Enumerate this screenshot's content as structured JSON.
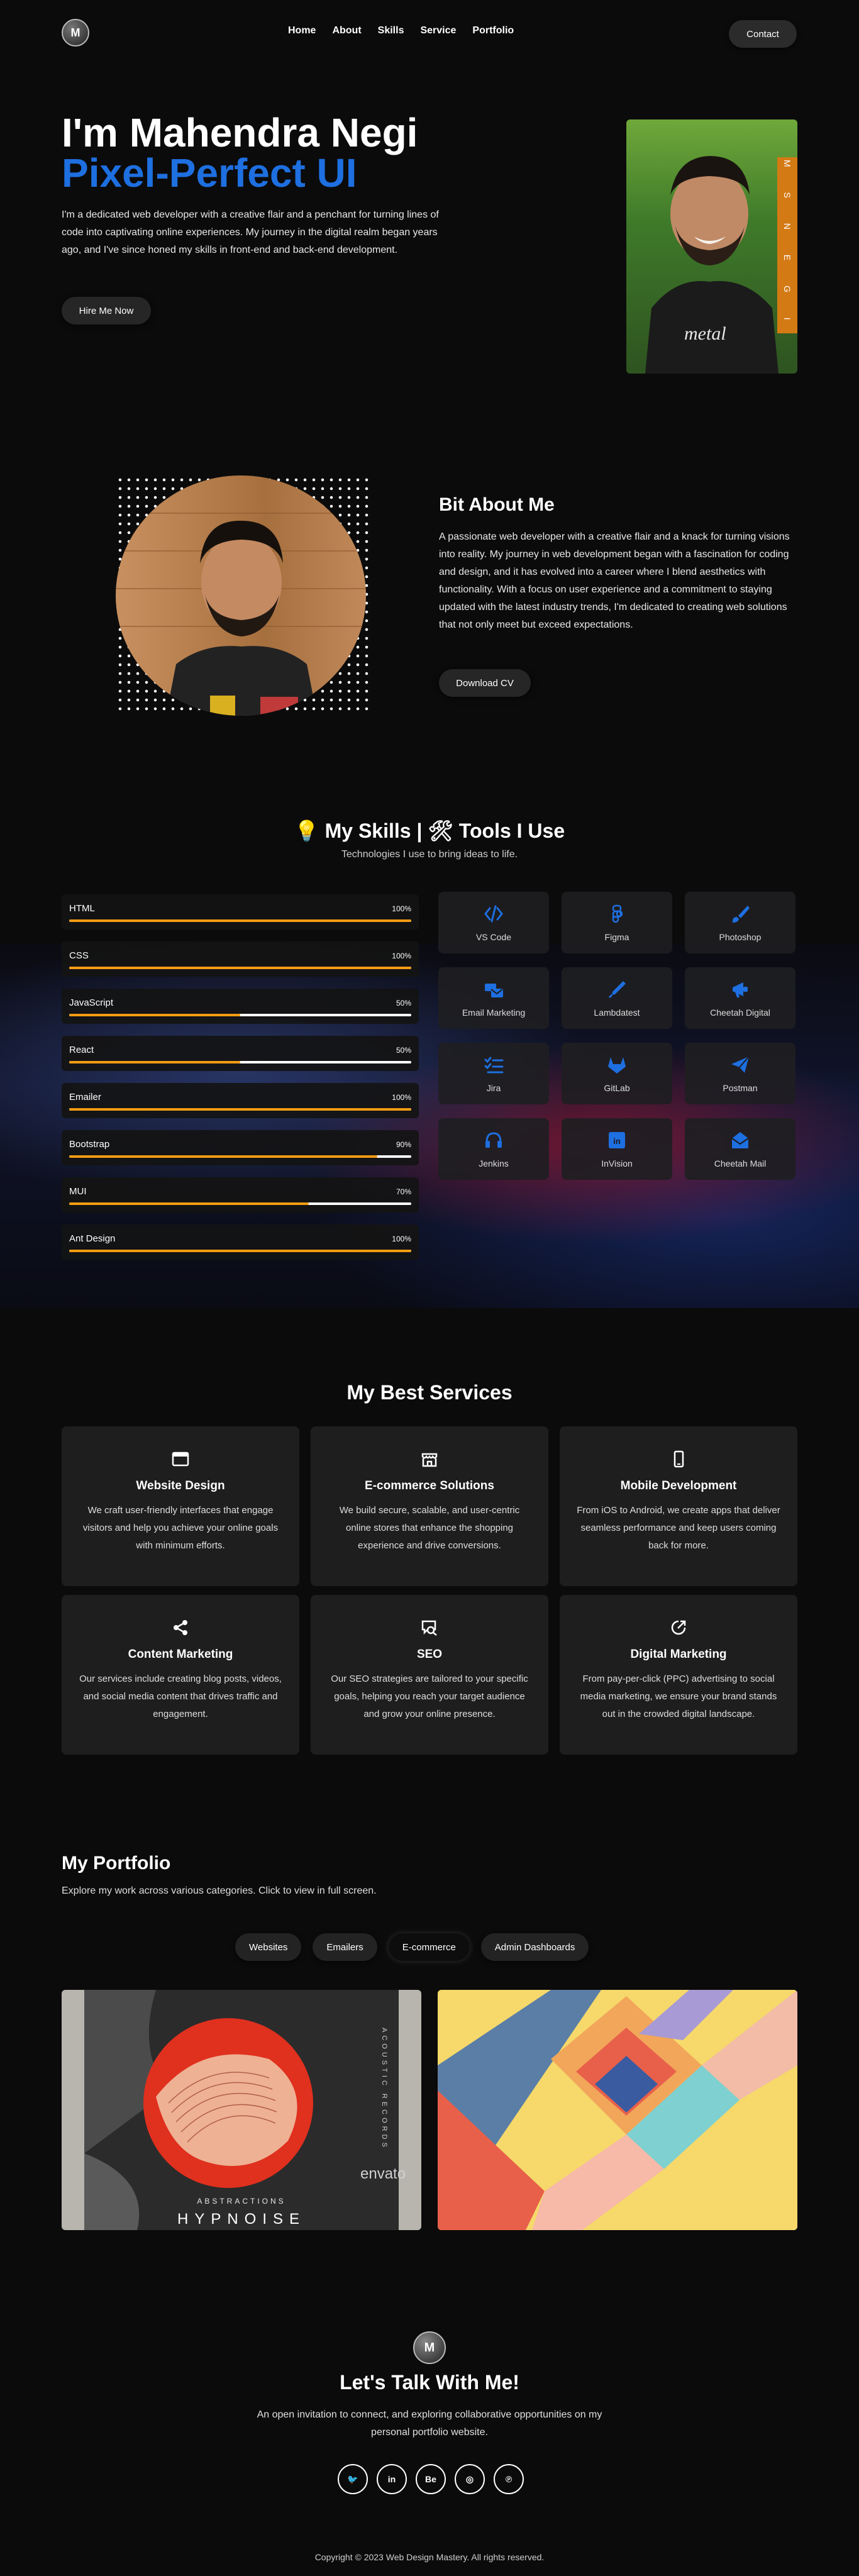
{
  "nav": {
    "logo": "M",
    "links": [
      "Home",
      "About",
      "Skills",
      "Service",
      "Portfolio"
    ],
    "contact": "Contact"
  },
  "hero": {
    "title": "I'm Mahendra Negi",
    "subtitle": "Pixel-Perfect UI",
    "description": "I'm a dedicated web developer with a creative flair and a penchant for turning lines of code into captivating online experiences. My journey in the digital realm began years ago, and I've since honed my skills in front-end and back-end development.",
    "button": "Hire Me Now",
    "photo_label": "M S N E G I",
    "shirt_text": "metal"
  },
  "about": {
    "title": "Bit About Me",
    "description": "A passionate web developer with a creative flair and a knack for turning visions into reality. My journey in web development began with a fascination for coding and design, and it has evolved into a career where I blend aesthetics with functionality. With a focus on user experience and a commitment to staying updated with the latest industry trends, I'm dedicated to creating web solutions that not only meet but exceed expectations.",
    "button": "Download CV"
  },
  "skills": {
    "title": "💡 My Skills | 🛠 Tools I Use",
    "subtitle": "Technologies I use to bring ideas to life.",
    "items": [
      {
        "name": "HTML",
        "percent": 100,
        "label": "100%"
      },
      {
        "name": "CSS",
        "percent": 100,
        "label": "100%"
      },
      {
        "name": "JavaScript",
        "percent": 50,
        "label": "50%"
      },
      {
        "name": "React",
        "percent": 50,
        "label": "50%"
      },
      {
        "name": "Emailer",
        "percent": 100,
        "label": "100%"
      },
      {
        "name": "Bootstrap",
        "percent": 90,
        "label": "90%"
      },
      {
        "name": "MUI",
        "percent": 70,
        "label": "70%"
      },
      {
        "name": "Ant Design",
        "percent": 100,
        "label": "100%"
      }
    ],
    "tools": [
      {
        "name": "VS Code",
        "icon": "code-icon"
      },
      {
        "name": "Figma",
        "icon": "figma-icon"
      },
      {
        "name": "Photoshop",
        "icon": "brush-icon"
      },
      {
        "name": "Email Marketing",
        "icon": "mail-bulk-icon"
      },
      {
        "name": "Lambdatest",
        "icon": "pipette-icon"
      },
      {
        "name": "Cheetah Digital",
        "icon": "megaphone-icon"
      },
      {
        "name": "Jira",
        "icon": "list-check-icon"
      },
      {
        "name": "GitLab",
        "icon": "gitlab-icon"
      },
      {
        "name": "Postman",
        "icon": "paper-plane-icon"
      },
      {
        "name": "Jenkins",
        "icon": "headset-icon"
      },
      {
        "name": "InVision",
        "icon": "invision-icon"
      },
      {
        "name": "Cheetah Mail",
        "icon": "envelope-open-icon"
      }
    ],
    "accent": "#f39c12",
    "tool_icon_color": "#1e6fe0"
  },
  "services": {
    "title": "My Best Services",
    "items": [
      {
        "title": "Website Design",
        "desc": "We craft user-friendly interfaces that engage visitors and help you achieve your online goals with minimum efforts.",
        "icon": "browser-window-icon"
      },
      {
        "title": "E-commerce Solutions",
        "desc": "We build secure, scalable, and user-centric online stores that enhance the shopping experience and drive conversions.",
        "icon": "storefront-icon"
      },
      {
        "title": "Mobile Development",
        "desc": "From iOS to Android, we create apps that deliver seamless performance and keep users coming back for more.",
        "icon": "mobile-phone-icon"
      },
      {
        "title": "Content Marketing",
        "desc": "Our services include creating blog posts, videos, and social media content that drives traffic and engagement.",
        "icon": "share-icon"
      },
      {
        "title": "SEO",
        "desc": "Our SEO strategies are tailored to your specific goals, helping you reach your target audience and grow your online presence.",
        "icon": "search-chat-icon"
      },
      {
        "title": "Digital Marketing",
        "desc": "From pay-per-click (PPC) advertising to social media marketing, we ensure your brand stands out in the crowded digital landscape.",
        "icon": "growth-arrow-icon"
      }
    ]
  },
  "portfolio": {
    "title": "My Portfolio",
    "subtitle": "Explore my work across various categories. Click to view in full screen.",
    "tabs": [
      "Websites",
      "Emailers",
      "E-commerce",
      "Admin Dashboards"
    ],
    "active_tab": "E-commerce",
    "card1": {
      "brand": "envato",
      "small": "ABSTRACTIONS",
      "big": "HYPNOISE",
      "side": "ACOUSTIC RECORDS"
    }
  },
  "footer": {
    "logo": "M",
    "title": "Let's Talk With Me!",
    "description": "An open invitation to connect, and exploring collaborative opportunities on my personal portfolio website.",
    "socials": [
      {
        "icon": "twitter-icon",
        "glyph": "🐦"
      },
      {
        "icon": "linkedin-icon",
        "glyph": "in"
      },
      {
        "icon": "behance-icon",
        "glyph": "Be"
      },
      {
        "icon": "dribbble-icon",
        "glyph": "◎"
      },
      {
        "icon": "pinterest-icon",
        "glyph": "℗"
      }
    ],
    "copyright": "Copyright © 2023 Web Design Mastery. All rights reserved."
  }
}
